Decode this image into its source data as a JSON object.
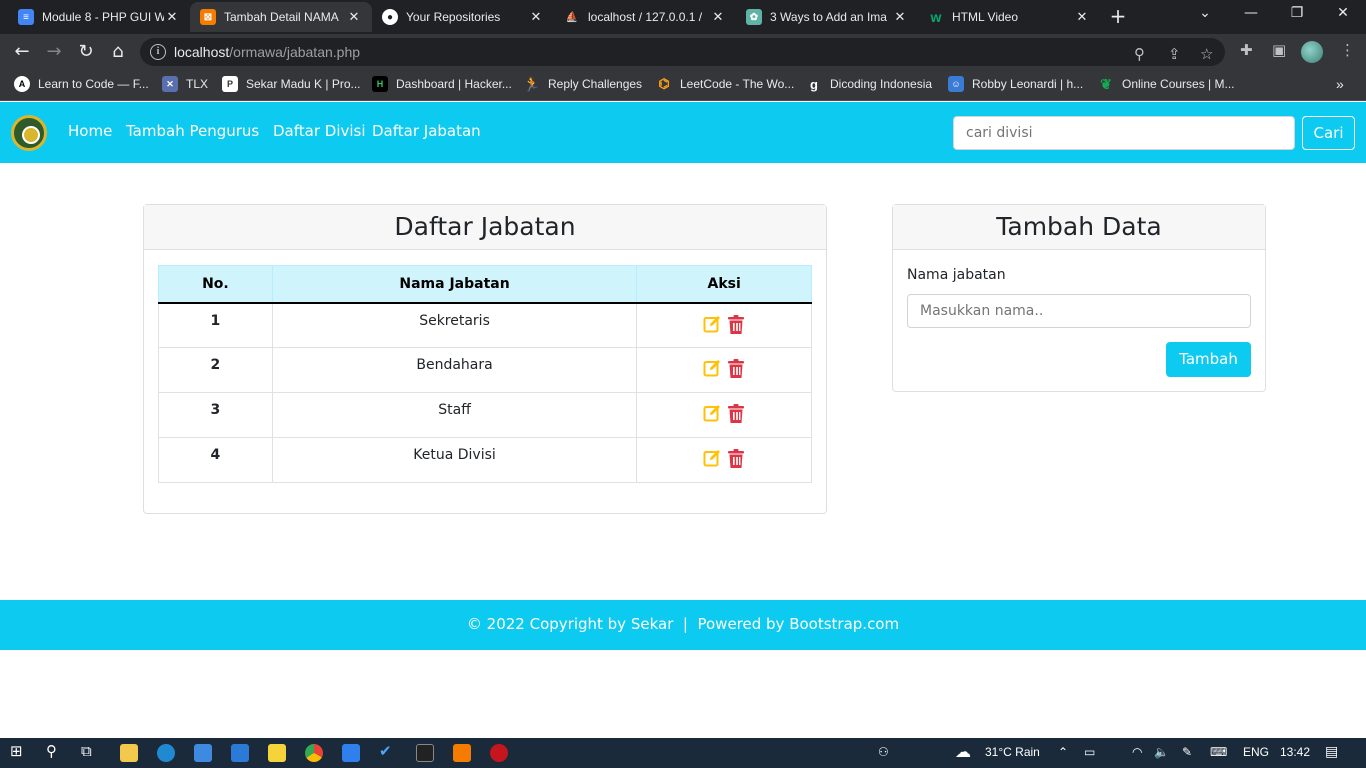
{
  "browser": {
    "tabs": [
      {
        "title": "Module 8 - PHP GUI W",
        "icon_color": "#4285f4"
      },
      {
        "title": "Tambah Detail NAMA",
        "icon_color": "#f57c00"
      },
      {
        "title": "Your Repositories",
        "icon_color": "#e8eaed"
      },
      {
        "title": "localhost / 127.0.0.1 /",
        "icon_color": "#f0a30a"
      },
      {
        "title": "3 Ways to Add an Ima",
        "icon_color": "#5fb4a7"
      },
      {
        "title": "HTML Video",
        "icon_color": "#04aa6d"
      }
    ],
    "url_host": "localhost",
    "url_path": "/ormawa/jabatan.php",
    "bookmarks": [
      "Learn to Code — F...",
      "TLX",
      "Sekar Madu K | Pro...",
      "Dashboard | Hacker...",
      "Reply Challenges",
      "LeetCode - The Wo...",
      "Dicoding Indonesia",
      "Robby Leonardi | h...",
      "Online Courses | M..."
    ]
  },
  "nav": {
    "links": [
      "Home",
      "Tambah Pengurus",
      "Daftar Divisi",
      "Daftar Jabatan"
    ],
    "search_placeholder": "cari divisi",
    "search_button": "Cari"
  },
  "list_card": {
    "title": "Daftar Jabatan",
    "columns": [
      "No.",
      "Nama Jabatan",
      "Aksi"
    ],
    "rows": [
      {
        "no": "1",
        "name": "Sekretaris"
      },
      {
        "no": "2",
        "name": "Bendahara"
      },
      {
        "no": "3",
        "name": "Staff"
      },
      {
        "no": "4",
        "name": "Ketua Divisi"
      }
    ]
  },
  "form_card": {
    "title": "Tambah Data",
    "label": "Nama jabatan",
    "placeholder": "Masukkan nama..",
    "button": "Tambah"
  },
  "footer": {
    "text": "© 2022 Copyright by Sekar  |  Powered by Bootstrap.com"
  },
  "taskbar": {
    "weather": "31°C  Rain",
    "lang": "ENG",
    "time": "13:42"
  },
  "colors": {
    "accent": "#0dcaf0",
    "edit": "#ffc107",
    "delete": "#dc3545"
  }
}
